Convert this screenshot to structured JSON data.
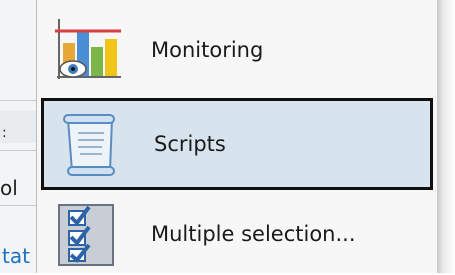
{
  "background": {
    "fragments": [
      ":",
      "ol",
      "tat"
    ]
  },
  "menu": {
    "items": [
      {
        "label": "Monitoring",
        "icon": "monitoring-chart-icon",
        "selected": false
      },
      {
        "label": "Scripts",
        "icon": "script-scroll-icon",
        "selected": true
      },
      {
        "label": "Multiple selection...",
        "icon": "multiple-selection-checklist-icon",
        "selected": false
      }
    ]
  },
  "colors": {
    "selected_bg": "#d7e4ee",
    "selected_border": "#111111",
    "menu_bg": "#f7f7f7"
  }
}
